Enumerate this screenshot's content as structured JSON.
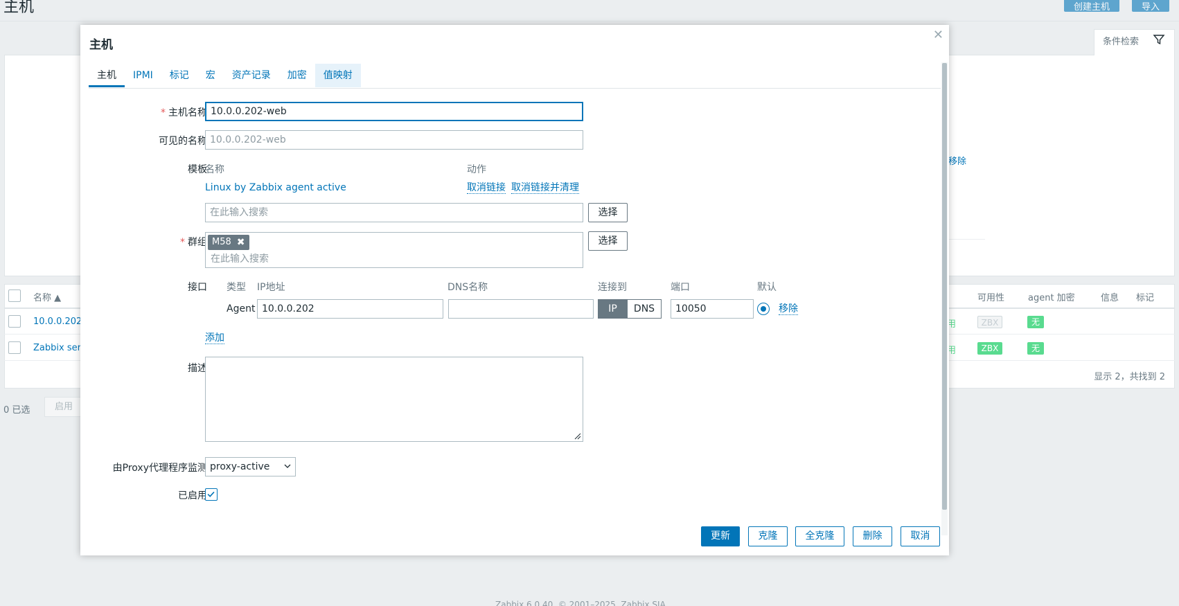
{
  "background": {
    "page_title": "主机",
    "create_host_button": "创建主机",
    "import_button": "导入",
    "filter_tab": "条件检索",
    "filter_remove_link": "移除",
    "table": {
      "columns": {
        "name": "名称 ▲",
        "availability": "可用性",
        "agent_encryption": "agent 加密",
        "info": "信息",
        "tags": "标记"
      },
      "rows": [
        {
          "name": "10.0.0.202",
          "status": "用",
          "availability": "ZBX",
          "encryption": "无"
        },
        {
          "name": "Zabbix ser",
          "status": "用",
          "availability": "ZBX",
          "encryption": "无"
        }
      ],
      "summary": "显示 2，共找到 2"
    },
    "selected_count": "0 已选",
    "enable_button": "启用",
    "footer_text": "Zabbix 6.0.40. © 2001–2025, Zabbix SIA"
  },
  "dialog": {
    "title": "主机",
    "tabs": [
      "主机",
      "IPMI",
      "标记",
      "宏",
      "资产记录",
      "加密",
      "值映射"
    ],
    "host_name": {
      "label": "主机名称",
      "value": "10.0.0.202-web"
    },
    "visible_name": {
      "label": "可见的名称",
      "placeholder": "10.0.0.202-web"
    },
    "templates": {
      "label": "模板",
      "col_name": "名称",
      "col_action": "动作",
      "linked": "Linux by Zabbix agent active",
      "unlink": "取消链接",
      "unlink_clear": "取消链接并清理",
      "search_placeholder": "在此输入搜索",
      "select_button": "选择"
    },
    "groups": {
      "label": "群组",
      "tag": "M58",
      "search_placeholder": "在此输入搜索",
      "select_button": "选择"
    },
    "interfaces": {
      "label": "接口",
      "headers": {
        "type": "类型",
        "ip": "IP地址",
        "dns": "DNS名称",
        "connect": "连接到",
        "port": "端口",
        "default": "默认"
      },
      "row": {
        "type": "Agent",
        "ip": "10.0.0.202",
        "dns": "",
        "connect_ip": "IP",
        "connect_dns": "DNS",
        "port": "10050",
        "remove": "移除"
      },
      "add": "添加"
    },
    "description": {
      "label": "描述",
      "value": ""
    },
    "proxy": {
      "label": "由Proxy代理程序监测",
      "value": "proxy-active"
    },
    "enabled": {
      "label": "已启用",
      "checked": true
    },
    "buttons": {
      "update": "更新",
      "clone": "克隆",
      "full_clone": "全克隆",
      "delete": "删除",
      "cancel": "取消"
    }
  },
  "colors": {
    "accent": "#0275b8",
    "required": "#e45959",
    "tag_bg": "#687882",
    "badge_green": "#59db8f"
  }
}
